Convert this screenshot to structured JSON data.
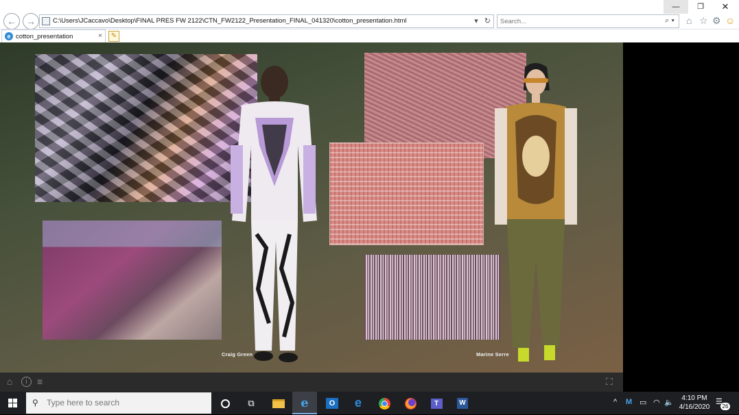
{
  "browser": {
    "url": "C:\\Users\\JCaccavo\\Desktop\\FINAL PRES FW 2122\\CTN_FW2122_Presentation_FINAL_041320\\cotton_presentation.html",
    "search_placeholder": "Search...",
    "tab_label": "cotton_presentation",
    "tab_close": "×",
    "icons": {
      "back": "back-arrow-icon",
      "forward": "forward-arrow-icon",
      "refresh": "refresh-icon",
      "home": "home-icon",
      "favorites": "star-icon",
      "tools": "gear-icon",
      "feedback": "smiley-icon"
    }
  },
  "window_controls": {
    "minimize": "—",
    "restore": "❐",
    "close": "✕"
  },
  "slide": {
    "captions": {
      "craig": "Craig Green",
      "marine": "Marine Serre"
    },
    "controls": {
      "home": "⌂",
      "info": "i",
      "menu": "≡",
      "fullscreen": "⛶"
    }
  },
  "taskbar": {
    "search_placeholder": "Type here to search",
    "apps": [
      "cortana",
      "task-view",
      "file-explorer",
      "internet-explorer",
      "outlook",
      "edge",
      "chrome",
      "firefox",
      "teams",
      "word"
    ],
    "clock": {
      "time": "4:10 PM",
      "date": "4/16/2020"
    },
    "notification_count": "26"
  },
  "colors": {
    "slide_bg_dark": "#2e3b28",
    "slide_bg_warm": "#7a6045",
    "taskbar": "#1e1f23",
    "ie_blue": "#2f8bd3"
  }
}
